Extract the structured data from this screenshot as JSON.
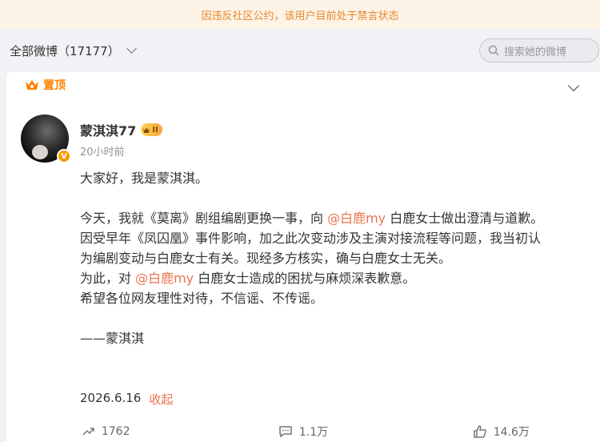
{
  "notice": {
    "text": "因违反社区公约，该用户目前处于禁言状态"
  },
  "filter": {
    "label": "全部微博（17177）",
    "search_placeholder": "搜索她的微博"
  },
  "pinned": {
    "label": "置顶"
  },
  "post": {
    "username": "蒙淇淇77",
    "level": "II",
    "time": "20小时前",
    "lines": [
      {
        "text": "大家好，我是蒙淇淇。"
      },
      {
        "text": ""
      },
      {
        "pre": "今天，我就《莫离》剧组编剧更换一事，向 ",
        "mention": "@白鹿my",
        "post": " 白鹿女士做出澄清与道歉。"
      },
      {
        "text": "因受早年《凤囚凰》事件影响，加之此次变动涉及主演对接流程等问题，我当初认"
      },
      {
        "text": "为编剧变动与白鹿女士有关。现经多方核实，确与白鹿女士无关。"
      },
      {
        "pre": "为此，对 ",
        "mention": "@白鹿my",
        "post": " 白鹿女士造成的困扰与麻烦深表歉意。"
      },
      {
        "text": "希望各位网友理性对待，不信谣、不传谣。"
      },
      {
        "text": ""
      },
      {
        "text": "——蒙淇淇"
      }
    ],
    "date": "2026.6.16",
    "collapse": "收起"
  },
  "actions": {
    "repost": "1762",
    "comment": "1.1万",
    "like": "14.6万"
  },
  "colors": {
    "accent": "#ff8200",
    "mention": "#eb7350",
    "notice_bg": "#fdf3e7"
  }
}
